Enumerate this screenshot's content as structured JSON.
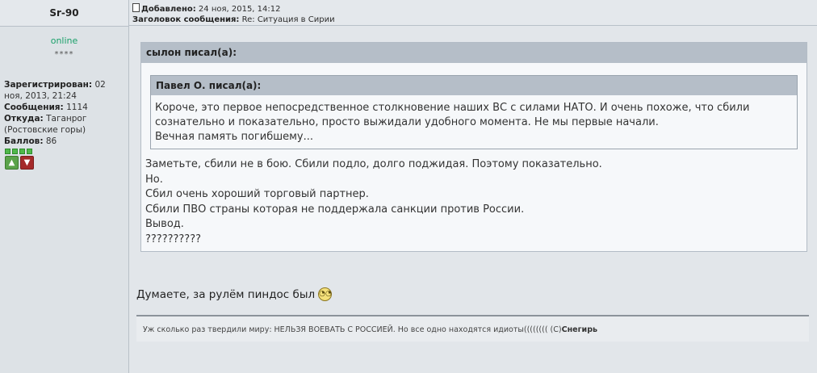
{
  "author": {
    "name": "Sr-90",
    "status": "online",
    "stars": "****",
    "registered_label": "Зарегистрирован:",
    "registered_value": "02 ноя, 2013, 21:24",
    "messages_label": "Сообщения:",
    "messages_value": "1114",
    "from_label": "Откуда:",
    "from_value": "Таганрог (Ростовские горы)",
    "points_label": "Баллов:",
    "points_value": "86"
  },
  "post": {
    "added_label": "Добавлено:",
    "added_value": "24 ноя, 2015, 14:12",
    "subject_label": "Заголовок сообщения:",
    "subject_value": "Re: Ситуация в Сирии"
  },
  "quote_outer": {
    "title": "сылон писал(а):",
    "lines": [
      "Заметьте, сбили не в бою. Сбили подло, долго поджидая. Поэтому показательно.",
      "Но.",
      "Сбил очень хороший торговый партнер.",
      "Сбили ПВО страны которая не поддержала санкции против России.",
      "Вывод.",
      "??????????"
    ]
  },
  "quote_inner": {
    "title": "Павел О. писал(а):",
    "lines": [
      "Короче, это первое непосредственное столкновение наших ВС с силами НАТО. И очень похоже, что сбили",
      "сознательно и показательно, просто выжидали удобного момента. Не мы первые начали.",
      "Вечная память погибшему..."
    ]
  },
  "message": "Думаете, за рулём пиндос был",
  "signature": {
    "text": "Уж сколько раз твердили миру: НЕЛЬЗЯ ВОЕВАТЬ С РОССИЕЙ. Но все одно находятся идиоты(((((((( (С)",
    "author": "Снегирь"
  },
  "icons": {
    "post_icon": "document-icon",
    "rate_up": "thumbs-up-icon",
    "rate_down": "thumbs-down-icon",
    "smiley": "confused-smiley-icon"
  }
}
